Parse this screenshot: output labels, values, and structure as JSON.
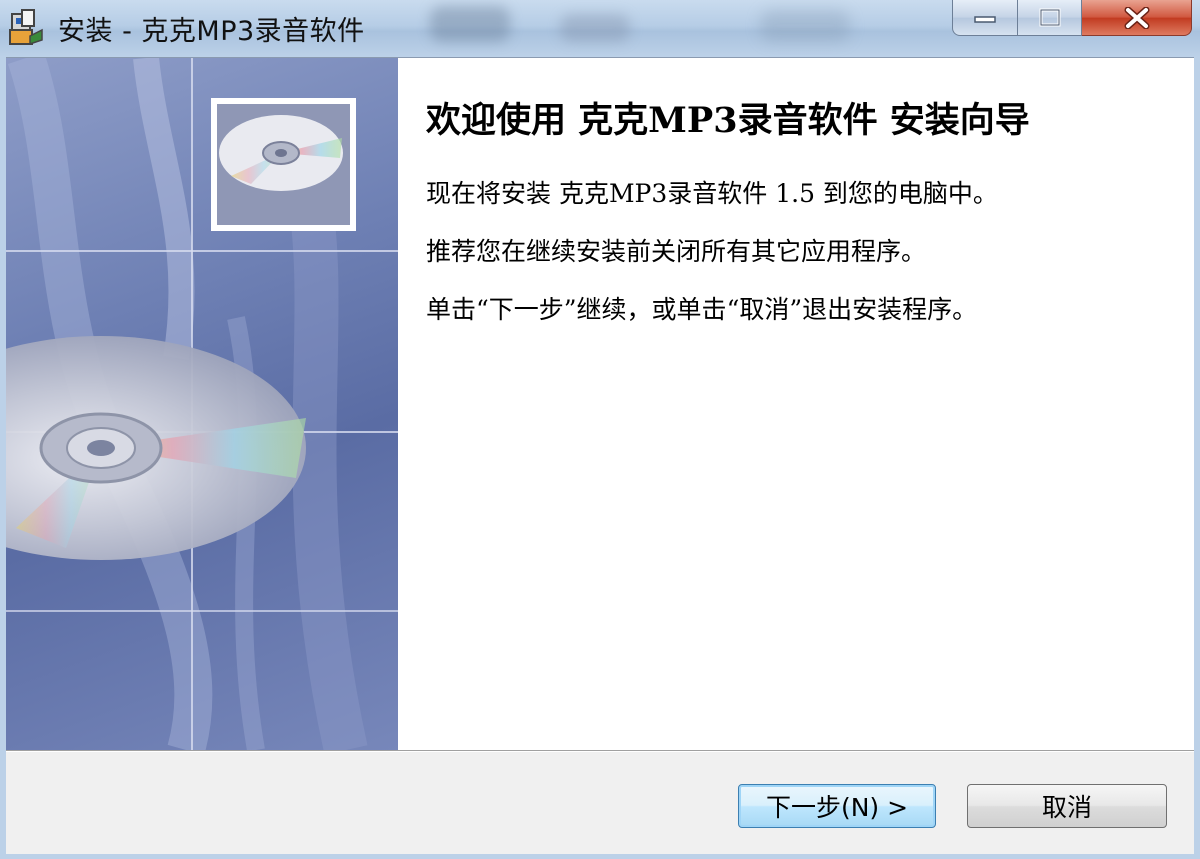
{
  "window": {
    "title": "安装 - 克克MP3录音软件",
    "controls": [
      "minimize",
      "maximize",
      "close"
    ]
  },
  "wizard": {
    "heading": "欢迎使用 克克MP3录音软件 安装向导",
    "paragraphs": [
      "现在将安装 克克MP3录音软件 1.5 到您的电脑中。",
      "推荐您在继续安装前关闭所有其它应用程序。",
      "单击“下一步”继续，或单击“取消”退出安装程序。"
    ]
  },
  "buttons": {
    "next_label": "下一步(N) >",
    "cancel_label": "取消"
  },
  "colors": {
    "banner_blue": "#6e80b4",
    "title_bar": "#b6cde6",
    "close_red": "#c13a20",
    "next_border": "#3c7fb1"
  },
  "icons": {
    "app": "installer-box-icon",
    "banner_small": "cd-disc-icon",
    "banner_large": "cd-disc-icon"
  }
}
